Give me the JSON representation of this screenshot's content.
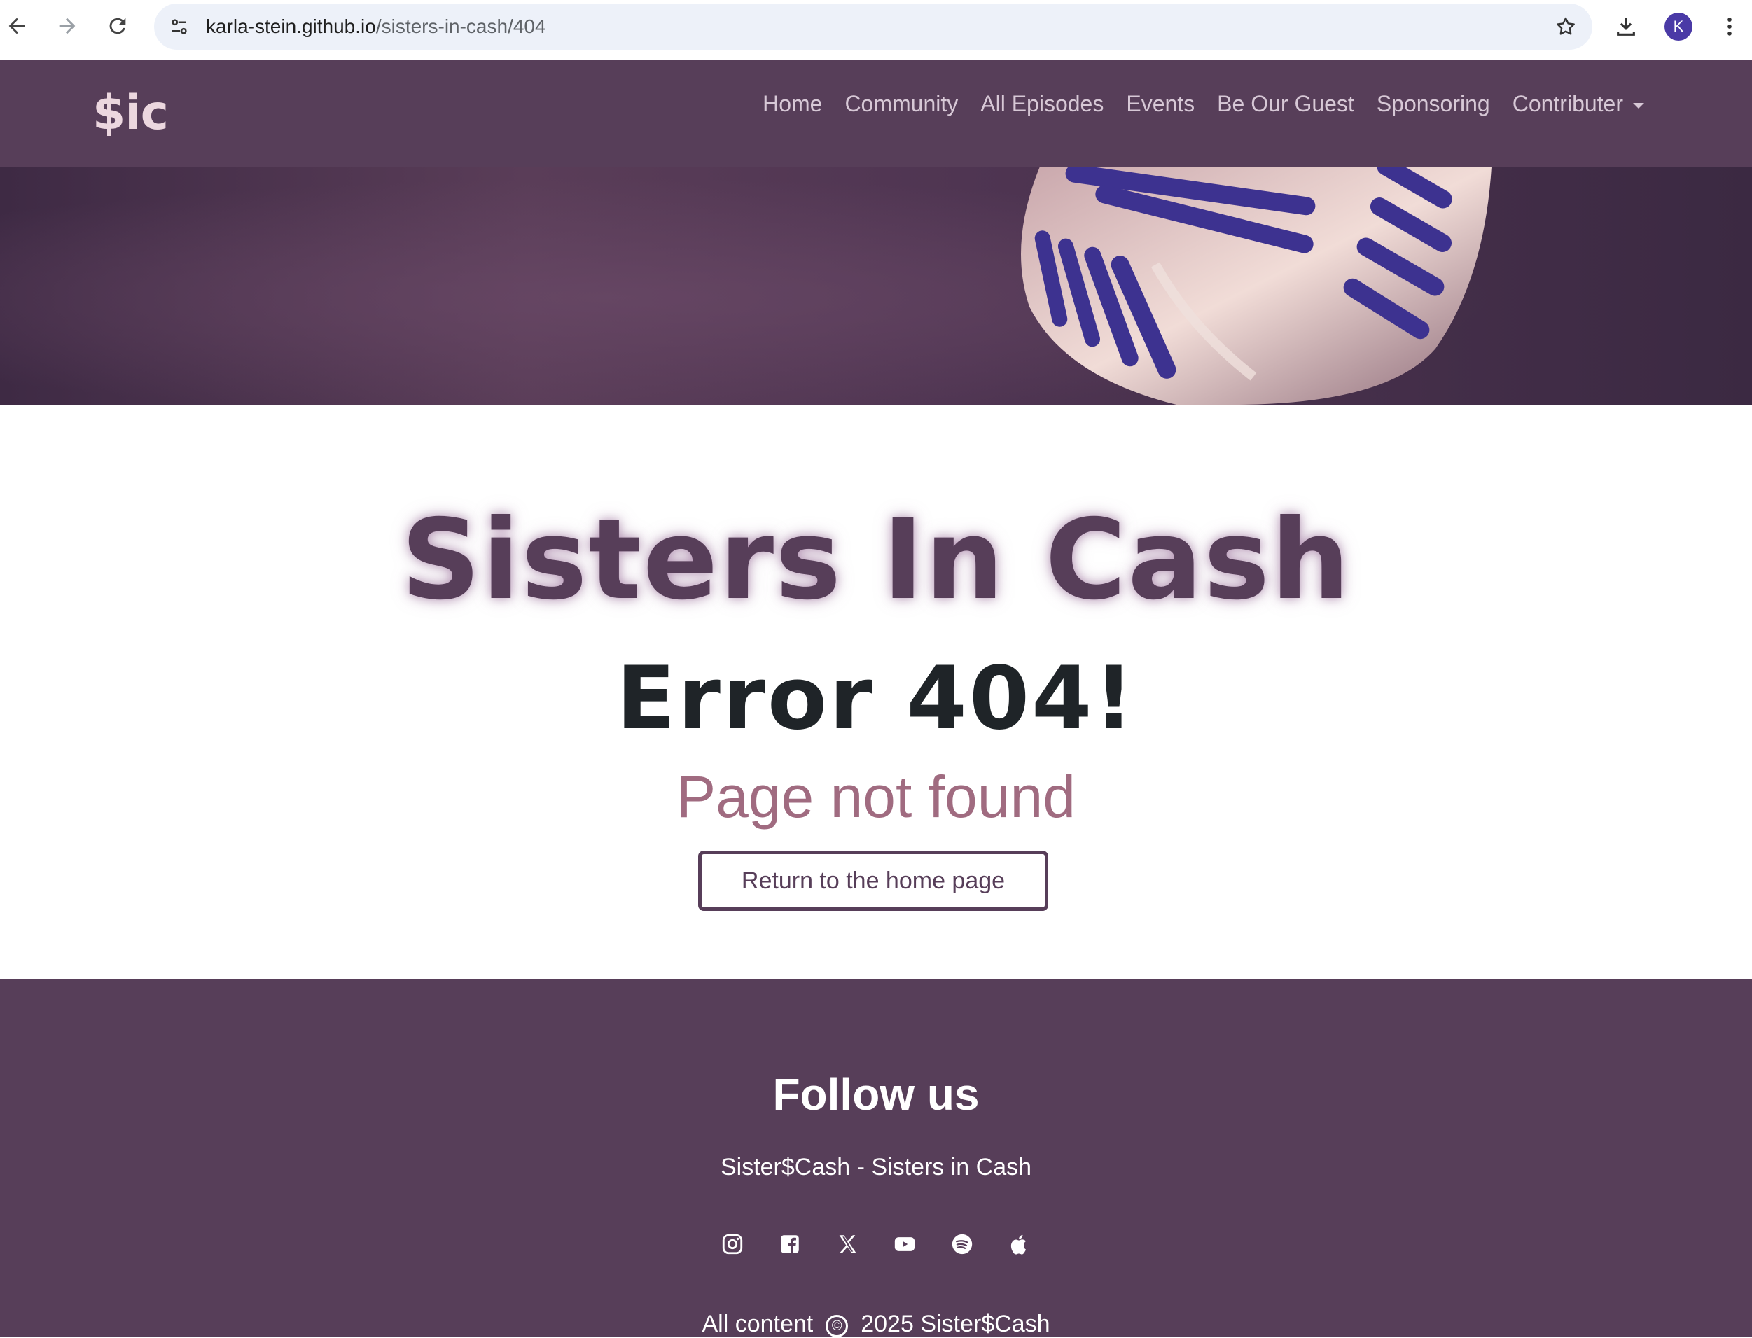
{
  "browser": {
    "url_host": "karla-stein.github.io",
    "url_path": "/sisters-in-cash/404",
    "profile_initial": "K"
  },
  "navbar": {
    "brand": "$ic",
    "items": [
      {
        "label": "Home"
      },
      {
        "label": "Community"
      },
      {
        "label": "All Episodes"
      },
      {
        "label": "Events"
      },
      {
        "label": "Be Our Guest"
      },
      {
        "label": "Sponsoring"
      },
      {
        "label": "Contributer"
      }
    ]
  },
  "main": {
    "site_title": "Sisters In Cash",
    "error_title": "Error 404!",
    "error_subtitle": "Page not found",
    "home_button": "Return to the home page"
  },
  "footer": {
    "heading": "Follow us",
    "tagline": "Sister$Cash - Sisters in Cash",
    "social_icons": [
      "instagram-icon",
      "facebook-icon",
      "x-icon",
      "youtube-icon",
      "spotify-icon",
      "apple-icon"
    ],
    "copyright_prefix": "All content",
    "copyright_symbol": "©",
    "copyright_text": "2025 Sister$Cash"
  },
  "colors": {
    "brand_purple": "#573e59",
    "subtitle_pink": "#a06b80",
    "brand_logo": "#ecd7df"
  }
}
